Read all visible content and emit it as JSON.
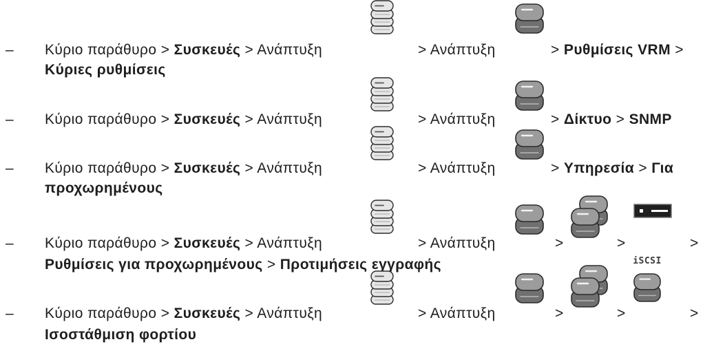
{
  "colors": {
    "text": "#1e1e1e",
    "icon_light": "#e6e6e6",
    "icon_dark_top": "#9c9c9c",
    "icon_dark": "#707070",
    "icon_outline": "#2b2b2b"
  },
  "bullet": "–",
  "separator": ">",
  "path": {
    "main_window": "Κύριο παράθυρο",
    "devices": "Συσκευές",
    "expand": "Ανάπτυξη"
  },
  "icons": {
    "vrm_devices": "vrm-devices-icon",
    "vrm_device": "vrm-device-icon",
    "storage_pool": "storage-pool-icon",
    "encoder": "encoder-icon",
    "iscsi_device": "iscsi-device-icon",
    "iscsi_label": "iSCSI"
  },
  "items": [
    {
      "line1": [
        "Ρυθμίσεις VRM"
      ],
      "line2": [
        "Κύριες ρυθμίσεις"
      ]
    },
    {
      "line1": [
        "Δίκτυο",
        "SNMP"
      ]
    },
    {
      "line1": [
        "Υπηρεσία",
        "Για"
      ],
      "line2": [
        "προχωρημένους"
      ]
    },
    {
      "line2": [
        "Ρυθμίσεις για προχωρημένους",
        "Προτιμήσεις εγγραφής"
      ]
    },
    {
      "line2": [
        "Ισοστάθμιση φορτίου"
      ]
    }
  ]
}
